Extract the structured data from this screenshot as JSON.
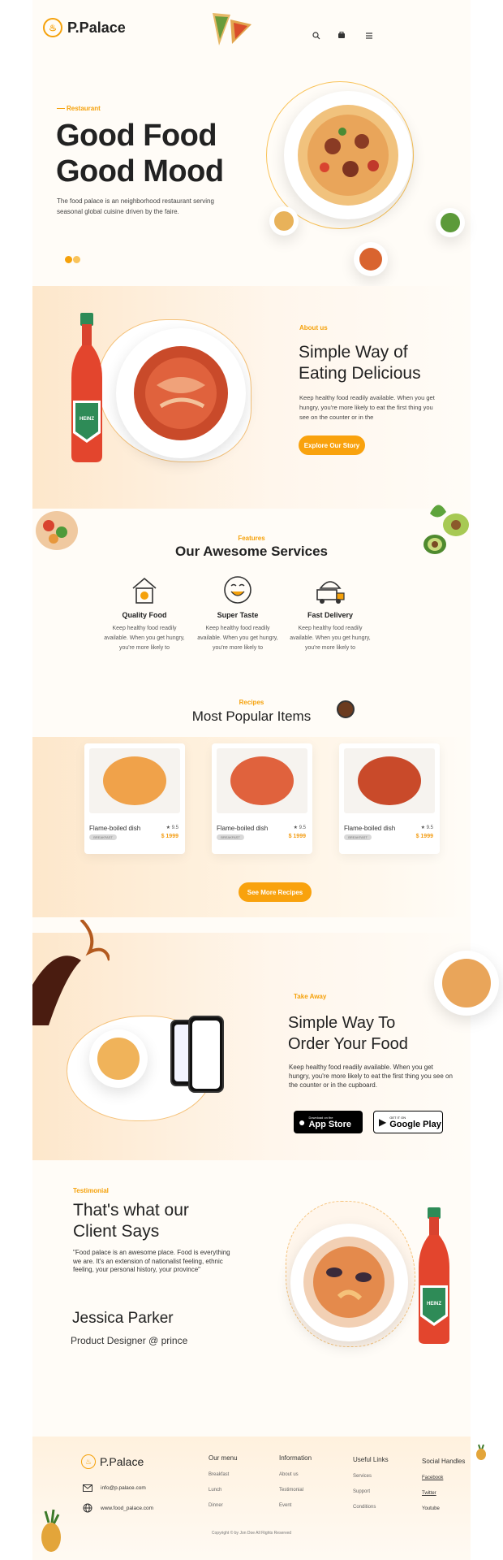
{
  "header": {
    "brand": "P.Palace"
  },
  "hero": {
    "eyebrow": "Restaurant",
    "title_line1": "Good Food",
    "title_line2": "Good Mood",
    "description": "The food palace is an neighborhood restaurant serving seasonal global cuisine driven by the faire."
  },
  "about": {
    "eyebrow": "About us",
    "title_line1": "Simple Way of",
    "title_line2": "Eating Delicious",
    "description": "Keep healthy food readily available. When you get hungry, you're more likely to eat the first thing you see on the counter or in the",
    "button": "Explore Our Story"
  },
  "services": {
    "eyebrow": "Features",
    "title": "Our Awesome Services",
    "items": [
      {
        "title": "Quality Food",
        "desc": "Keep healthy food readily available. When you get hungry, you're more likely to"
      },
      {
        "title": "Super Taste",
        "desc": "Keep healthy food readily available. When you get hungry, you're more likely to"
      },
      {
        "title": "Fast Delivery",
        "desc": "Keep healthy food readily available. When you get hungry, you're more likely to"
      }
    ]
  },
  "popular": {
    "eyebrow": "Recipes",
    "title": "Most Popular Items",
    "cards": [
      {
        "name": "Flame-boiled dish",
        "tag": "BREAKFAST",
        "rating": "★ 9.5",
        "price": "$ 1999"
      },
      {
        "name": "Flame-boiled dish",
        "tag": "BREAKFAST",
        "rating": "★ 9.5",
        "price": "$ 1999"
      },
      {
        "name": "Flame-boiled dish",
        "tag": "BREAKFAST",
        "rating": "★ 9.5",
        "price": "$ 1999"
      }
    ],
    "button": "See More Recipes"
  },
  "takeaway": {
    "eyebrow": "Take Away",
    "title_line1": "Simple Way To",
    "title_line2": "Order Your Food",
    "description": "Keep healthy food readily available. When you get hungry, you're more likely to eat the first thing you see on the counter or in the cupboard.",
    "appstore_small": "Download on the",
    "appstore": "App Store",
    "googleplay_small": "GET IT ON",
    "googleplay": "Google Play"
  },
  "testimonial": {
    "eyebrow": "Testimonial",
    "title_line1": "That's what our",
    "title_line2": "Client Says",
    "quote": "\"Food palace is an awesome place. Food is everything we are. It's an extension of nationalist feeling, ethnic feeling, your personal history, your province\"",
    "name": "Jessica Parker",
    "role": "Product Designer @ prince"
  },
  "footer": {
    "brand": "P.Palace",
    "email": "info@p.palace.com",
    "website": "www.food_palace.com",
    "columns": [
      {
        "title": "Our menu",
        "links": [
          "Breakfast",
          "Lunch",
          "Dinner"
        ]
      },
      {
        "title": "Information",
        "links": [
          "About us",
          "Testimonial",
          "Event"
        ]
      },
      {
        "title": "Useful Links",
        "links": [
          "Services",
          "Support",
          "Conditions"
        ]
      },
      {
        "title": "Social Handles",
        "links": [
          "Facebook",
          "Twitter",
          "Youtube"
        ]
      }
    ],
    "copyright": "Copyright © by Jon Doe All Rights Reserved"
  },
  "colors": {
    "accent": "#f9a20d",
    "background": "#fffcf7"
  }
}
